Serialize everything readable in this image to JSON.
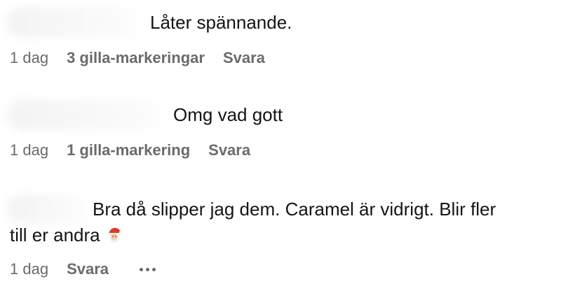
{
  "comments": [
    {
      "text": "Låter spännande.",
      "time": "1 dag",
      "likes": "3 gilla-markeringar",
      "reply": "Svara"
    },
    {
      "text": "Omg vad gott",
      "time": "1 dag",
      "likes": "1 gilla-markering",
      "reply": "Svara"
    },
    {
      "text_line1": "Bra då slipper jag dem. Caramel är vidrigt. Blir fler",
      "text_line2": "till er andra",
      "emoji_icon": "santa-icon",
      "time": "1 dag",
      "reply": "Svara",
      "more_icon": "more-options-icon"
    }
  ]
}
